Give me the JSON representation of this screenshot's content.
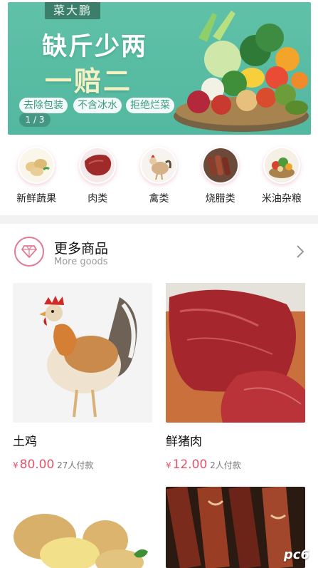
{
  "banner": {
    "brand": "菜大鹏",
    "headline_1": "缺斤少两",
    "headline_2": "一赔二",
    "pills": [
      "去除包装",
      "不含冰水",
      "拒绝烂菜"
    ],
    "indicator": "1 / 3"
  },
  "categories": [
    {
      "label": "新鲜蔬果",
      "icon": "potato-icon"
    },
    {
      "label": "肉类",
      "icon": "meat-icon"
    },
    {
      "label": "禽类",
      "icon": "chicken-icon"
    },
    {
      "label": "烧腊类",
      "icon": "cured-meat-icon"
    },
    {
      "label": "米油杂粮",
      "icon": "grain-basket-icon"
    }
  ],
  "section": {
    "title": "更多商品",
    "subtitle": "More goods"
  },
  "products": [
    {
      "name": "土鸡",
      "currency": "¥",
      "price": "80.00",
      "paid": "27人付款"
    },
    {
      "name": "鲜猪肉",
      "currency": "¥",
      "price": "12.00",
      "paid": "2人付款"
    }
  ],
  "watermark": "pc6",
  "colors": {
    "banner_green": "#55bba1",
    "price_red": "#e5536b",
    "accent_pink": "#e07a95"
  }
}
